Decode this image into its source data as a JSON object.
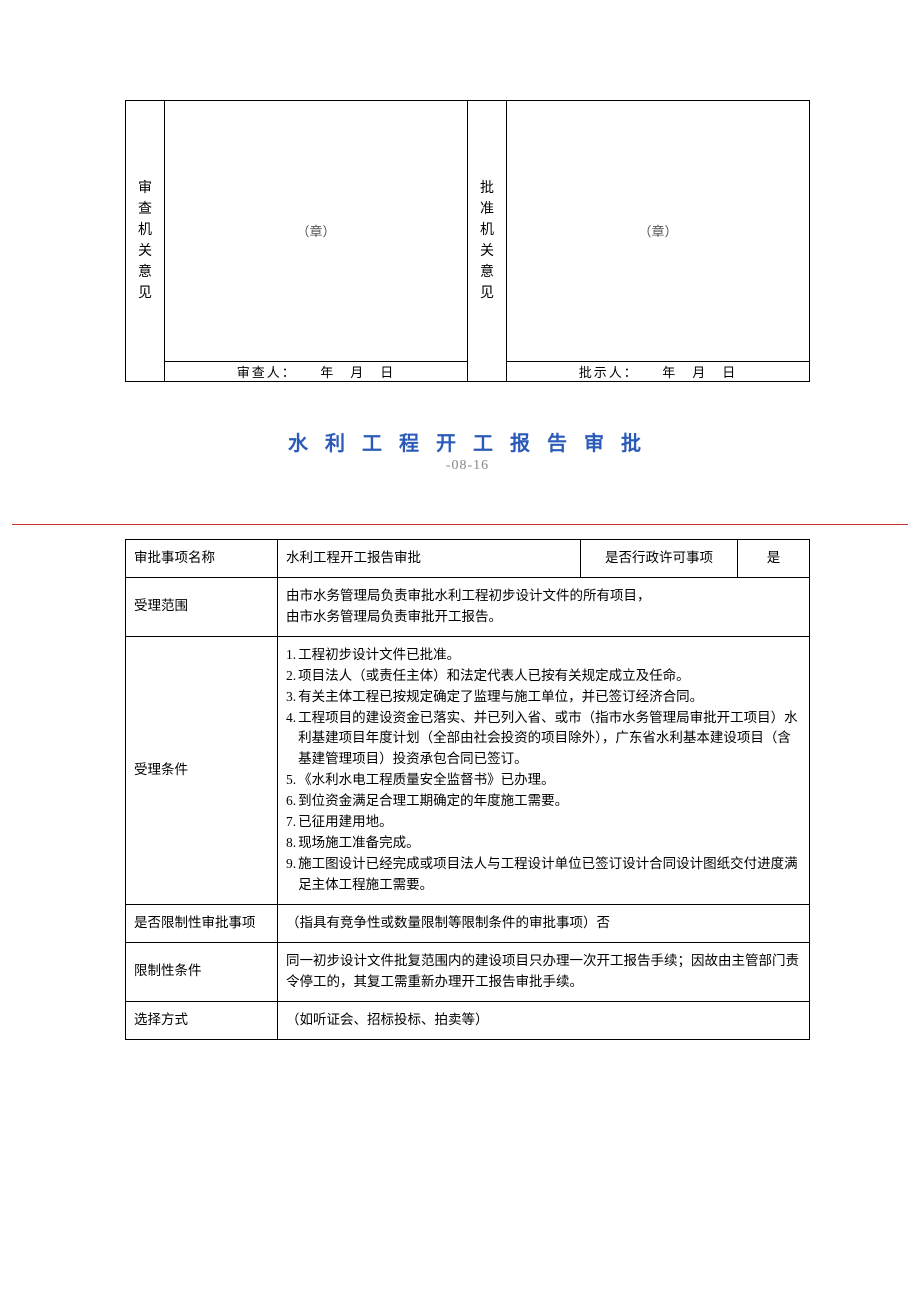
{
  "approval_box": {
    "left": {
      "header": "审查机关意见",
      "stamp": "（章）",
      "signer_label": "审查人：",
      "date_label": "年　月　日"
    },
    "right": {
      "header": "批准机关意见",
      "stamp": "（章）",
      "signer_label": "批示人：",
      "date_label": "年　月　日"
    }
  },
  "doc": {
    "title": "水 利 工 程 开 工 报 告 审 批",
    "date": "-08-16"
  },
  "info": {
    "rows": {
      "item_name": {
        "label": "审批事项名称",
        "value": "水利工程开工报告审批",
        "sub_label": "是否行政许可事项",
        "sub_value": "是"
      },
      "scope": {
        "label": "受理范围",
        "value_l1": "由市水务管理局负责审批水利工程初步设计文件的所有项目，",
        "value_l2": "由市水务管理局负责审批开工报告。"
      },
      "conditions": {
        "label": "受理条件",
        "items": [
          {
            "n": "1.",
            "t": "工程初步设计文件已批准。"
          },
          {
            "n": "2.",
            "t": "项目法人（或责任主体）和法定代表人已按有关规定成立及任命。"
          },
          {
            "n": "3.",
            "t": "有关主体工程已按规定确定了监理与施工单位，并已签订经济合同。"
          },
          {
            "n": "4.",
            "t": "工程项目的建设资金已落实、并已列入省、或市（指市水务管理局审批开工项目）水利基建项目年度计划（全部由社会投资的项目除外），广东省水利基本建设项目（含基建管理项目）投资承包合同已签订。"
          },
          {
            "n": "5.",
            "t": "《水利水电工程质量安全监督书》已办理。"
          },
          {
            "n": "6.",
            "t": "到位资金满足合理工期确定的年度施工需要。"
          },
          {
            "n": "7.",
            "t": "已征用建用地。"
          },
          {
            "n": "8.",
            "t": "现场施工准备完成。"
          },
          {
            "n": "9.",
            "t": "施工图设计已经完成或项目法人与工程设计单位已签订设计合同设计图纸交付进度满足主体工程施工需要。"
          }
        ]
      },
      "restrictive": {
        "label": "是否限制性审批事项",
        "value": "（指具有竞争性或数量限制等限制条件的审批事项）否"
      },
      "restrict_cond": {
        "label": "限制性条件",
        "value": "同一初步设计文件批复范围内的建设项目只办理一次开工报告手续；因故由主管部门责令停工的，其复工需重新办理开工报告审批手续。"
      },
      "select_mode": {
        "label": "选择方式",
        "value": "（如听证会、招标投标、拍卖等）"
      }
    }
  }
}
